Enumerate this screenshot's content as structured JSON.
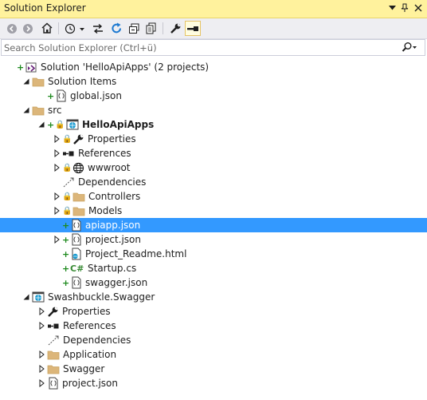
{
  "window": {
    "title": "Solution Explorer",
    "buttons": [
      "▼",
      "📌",
      "✕"
    ]
  },
  "search": {
    "placeholder": "Search Solution Explorer (Ctrl+ü)"
  },
  "toolbar": {
    "items": [
      "back-icon",
      "forward-icon",
      "home-icon",
      "history-dropdown",
      "sync-icon",
      "refresh-icon",
      "collapse-all-icon",
      "show-all-files-icon",
      "properties-wrench-icon",
      "preview-icon"
    ]
  },
  "tree": [
    {
      "label": "Solution 'HelloApiApps' (2 projects)",
      "icon": "solution-icon",
      "expander": "none",
      "indent": 0,
      "marker": "plus"
    },
    {
      "label": "Solution Items",
      "icon": "folder-icon",
      "expander": "expanded",
      "indent": 1
    },
    {
      "label": "global.json",
      "icon": "json-file-icon",
      "expander": "none",
      "indent": 2,
      "marker": "plus"
    },
    {
      "label": "src",
      "icon": "folder-icon",
      "expander": "expanded",
      "indent": 1
    },
    {
      "label": "HelloApiApps",
      "icon": "web-project-icon",
      "expander": "expanded",
      "indent": 2,
      "marker": "plus-lock",
      "bold": true
    },
    {
      "label": "Properties",
      "icon": "wrench-icon",
      "expander": "collapsed",
      "indent": 3,
      "marker": "lock"
    },
    {
      "label": "References",
      "icon": "references-icon",
      "expander": "collapsed",
      "indent": 3
    },
    {
      "label": "wwwroot",
      "icon": "globe-icon",
      "expander": "collapsed",
      "indent": 3,
      "marker": "lock"
    },
    {
      "label": "Dependencies",
      "icon": "dependencies-icon",
      "expander": "none",
      "indent": 3
    },
    {
      "label": "Controllers",
      "icon": "folder-icon",
      "expander": "collapsed",
      "indent": 3,
      "marker": "lock"
    },
    {
      "label": "Models",
      "icon": "folder-icon",
      "expander": "collapsed",
      "indent": 3,
      "marker": "lock"
    },
    {
      "label": "apiapp.json",
      "icon": "json-file-icon",
      "expander": "none",
      "indent": 3,
      "marker": "plus",
      "selected": true
    },
    {
      "label": "project.json",
      "icon": "json-file-icon",
      "expander": "collapsed",
      "indent": 3,
      "marker": "plus"
    },
    {
      "label": "Project_Readme.html",
      "icon": "html-file-icon",
      "expander": "none",
      "indent": 3,
      "marker": "plus"
    },
    {
      "label": "Startup.cs",
      "icon": "csharp-file-icon",
      "expander": "none",
      "indent": 3,
      "marker": "plus"
    },
    {
      "label": "swagger.json",
      "icon": "json-file-icon",
      "expander": "none",
      "indent": 3,
      "marker": "plus"
    },
    {
      "label": "Swashbuckle.Swagger",
      "icon": "web-project-icon",
      "expander": "expanded",
      "indent": 1
    },
    {
      "label": "Properties",
      "icon": "wrench-icon",
      "expander": "collapsed",
      "indent": 2
    },
    {
      "label": "References",
      "icon": "references-icon",
      "expander": "collapsed",
      "indent": 2
    },
    {
      "label": "Dependencies",
      "icon": "dependencies-icon",
      "expander": "none",
      "indent": 2
    },
    {
      "label": "Application",
      "icon": "folder-icon",
      "expander": "collapsed",
      "indent": 2
    },
    {
      "label": "Swagger",
      "icon": "folder-icon",
      "expander": "collapsed",
      "indent": 2
    },
    {
      "label": "project.json",
      "icon": "json-file-icon",
      "expander": "collapsed",
      "indent": 2
    }
  ],
  "colors": {
    "titlebar": "#fff29d",
    "selection": "#3399ff",
    "folder": "#dcb67a",
    "accent": "#1a9bd1"
  }
}
